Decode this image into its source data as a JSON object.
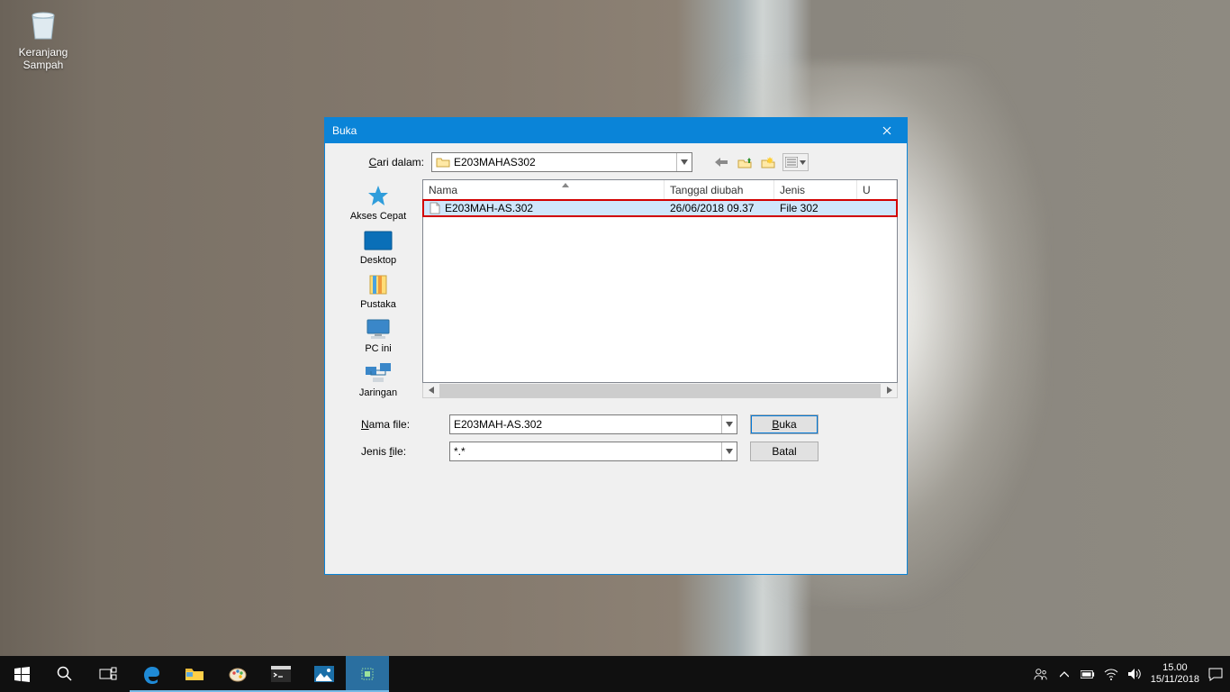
{
  "desktop": {
    "recycle_bin": "Keranjang Sampah"
  },
  "dialog": {
    "title": "Buka",
    "lookin_label": "Cari dalam:",
    "lookin_value": "E203MAHAS302",
    "columns": {
      "name": "Nama",
      "date": "Tanggal diubah",
      "type": "Jenis",
      "size": "U"
    },
    "places": {
      "quick": "Akses Cepat",
      "desktop": "Desktop",
      "libraries": "Pustaka",
      "thispc": "PC ini",
      "network": "Jaringan"
    },
    "row": {
      "name": "E203MAH-AS.302",
      "date": "26/06/2018 09.37",
      "type": "File 302"
    },
    "filename_label": "Nama file:",
    "filename_value": "E203MAH-AS.302",
    "filetype_label": "Jenis file:",
    "filetype_value": "*.*",
    "open_btn": "Buka",
    "cancel_btn": "Batal"
  },
  "taskbar": {
    "time": "15.00",
    "date": "15/11/2018"
  }
}
